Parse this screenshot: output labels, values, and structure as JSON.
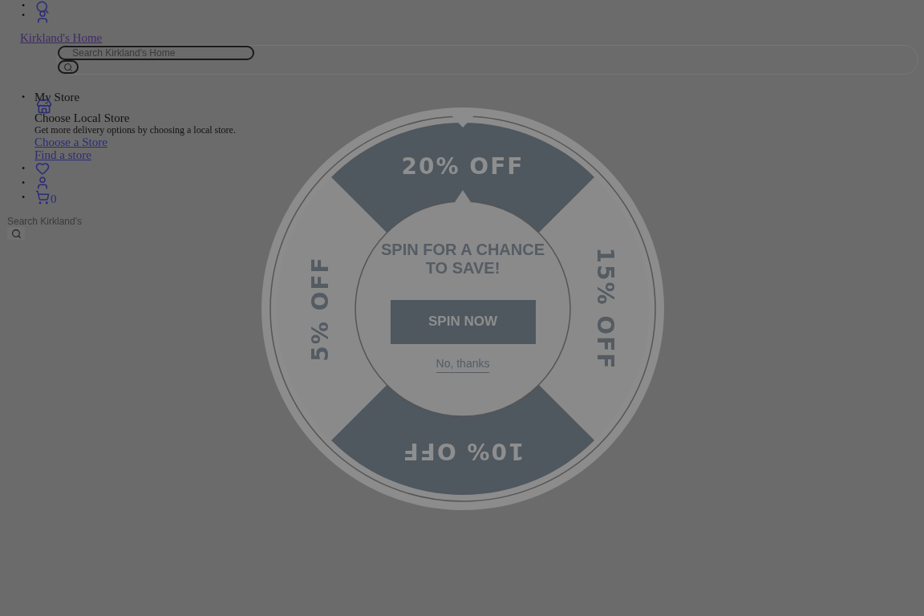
{
  "top_items": [
    {
      "marker": "•",
      "kind": "search"
    },
    {
      "marker": "•",
      "kind": "user"
    }
  ],
  "header": {
    "site_link": "Kirkland's Home",
    "search": {
      "placeholder": "Search Kirkland's Home"
    }
  },
  "store": {
    "marker": "•",
    "title": "My Store",
    "heading": "Choose Local Store",
    "description": "Get more delivery options by choosing a local store.",
    "links": [
      "Choose a Store",
      "Find a store"
    ]
  },
  "icon_items": [
    {
      "marker": "•",
      "kind": "heart"
    },
    {
      "marker": "•",
      "kind": "user"
    },
    {
      "marker": "•",
      "kind": "cart",
      "count": "0"
    }
  ],
  "bottom_search": {
    "placeholder": "Search Kirkland's"
  },
  "wheel": {
    "segments": [
      {
        "label": "20% OFF",
        "kind": "dark"
      },
      {
        "label": "15% OFF",
        "kind": "light"
      },
      {
        "label": "10% OFF",
        "kind": "dark"
      },
      {
        "label": "5% OFF",
        "kind": "light"
      }
    ],
    "heading": "SPIN FOR A CHANCE TO SAVE!",
    "button": "SPIN NOW",
    "dismiss": "No, thanks"
  }
}
